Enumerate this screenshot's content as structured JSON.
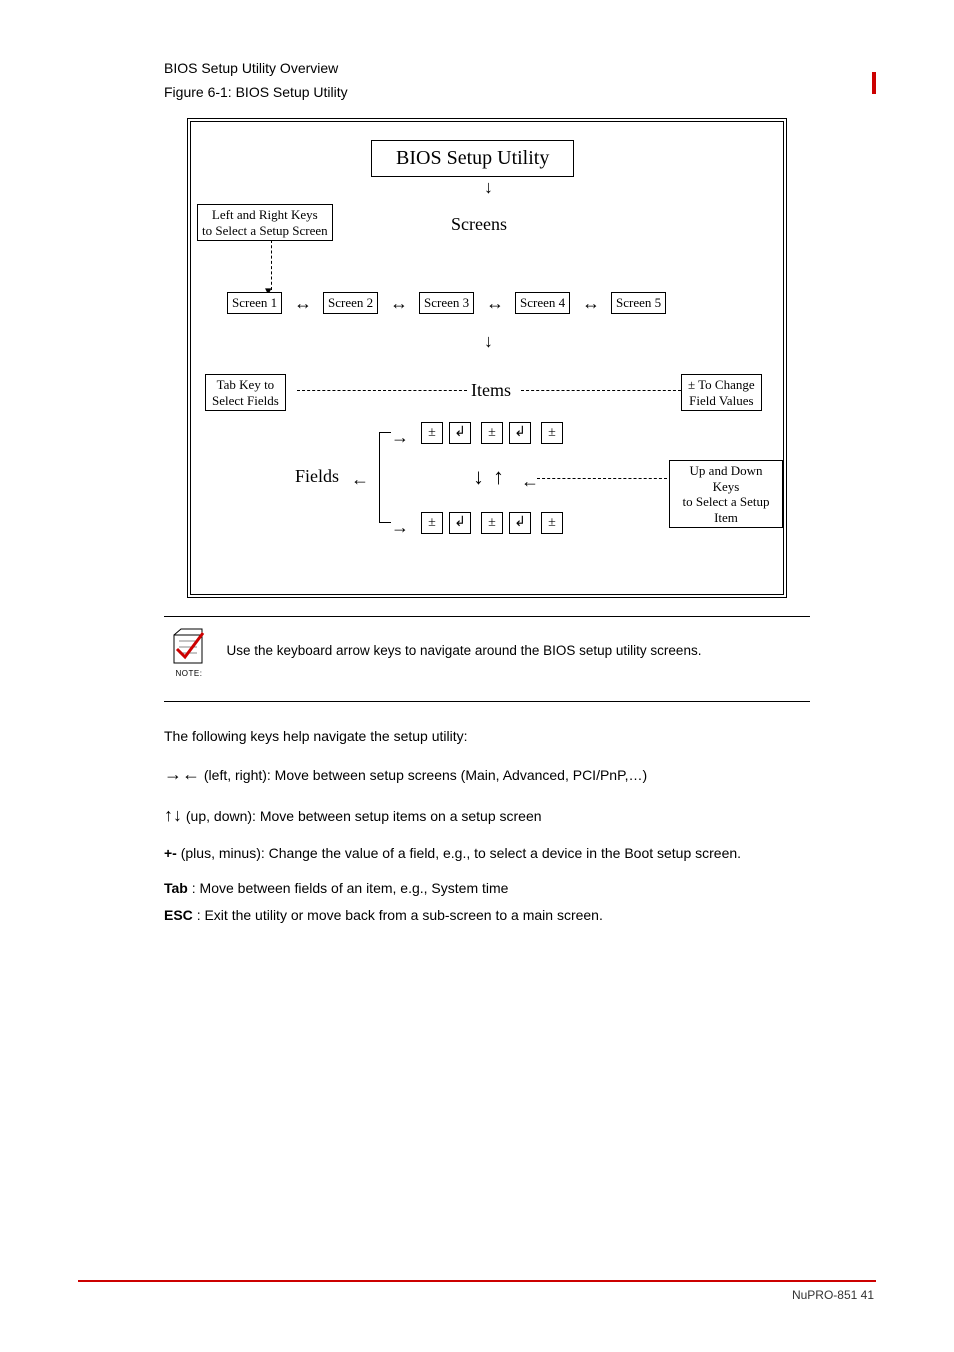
{
  "section_title": "BIOS Setup Utility Overview",
  "figure_label": "Figure 6-1: BIOS Setup Utility",
  "diagram": {
    "title_box": "BIOS Setup Utility",
    "lr_keys_box": "Left and Right Keys\nto Select a Setup Screen",
    "screens_label": "Screens",
    "screens": [
      "Screen 1",
      "Screen 2",
      "Screen 3",
      "Screen 4",
      "Screen 5"
    ],
    "tab_box": "Tab Key to\nSelect Fields",
    "items_label": "Items",
    "change_box": "± To Change\nField Values",
    "fields_label": "Fields",
    "ud_keys_box": "Up and Down Keys\nto Select a Setup Item",
    "pm": "±",
    "enter": "↲"
  },
  "note": {
    "label": "NOTE:",
    "text": "Use the keyboard arrow keys to navigate around the BIOS setup utility screens."
  },
  "keys_intro": "The following keys help navigate the setup utility:",
  "keys": [
    {
      "k": "→←",
      "d": "(left, right): Move between setup screens (Main, Advanced, PCI/PnP,…)"
    },
    {
      "k": "↑↓",
      "d": "(up, down): Move between setup items on a setup screen"
    },
    {
      "k": "+-",
      "d": "(plus, minus): Change the value of a field, e.g., to select a device in the Boot setup screen."
    },
    {
      "k": "Tab",
      "d": ": Move between fields of an item, e.g., System time"
    },
    {
      "k": "ESC",
      "d": ": Exit the utility or move back from a sub-screen to a main screen."
    }
  ],
  "footer": "NuPRO-851    41"
}
